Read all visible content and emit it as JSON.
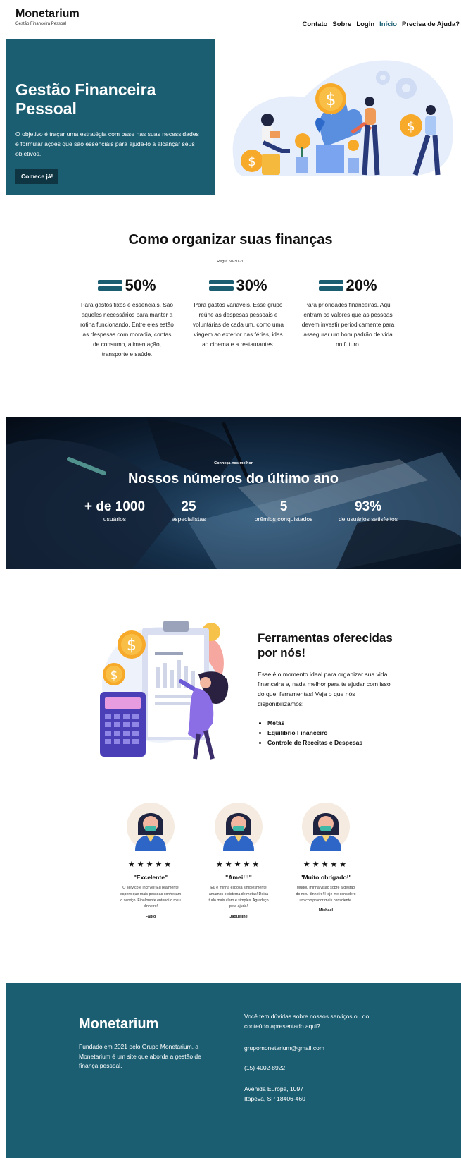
{
  "header": {
    "brand": "Monetarium",
    "tagline": "Gestão Financeira Pessoal",
    "nav": [
      "Contato",
      "Sobre",
      "Login",
      "Início",
      "Precisa de Ajuda?"
    ]
  },
  "hero": {
    "title": "Gestão Financeira Pessoal",
    "text": "O objetivo é traçar uma estratégia com base nas suas necessidades e formular ações que são essenciais para ajudá-lo a alcançar seus objetivos.",
    "button": "Comece já!"
  },
  "rule": {
    "title": "Como organizar suas finanças",
    "subtitle": "Regra 50-30-20",
    "columns": [
      {
        "pct": "50%",
        "text": "Para gastos fixos e essenciais. São aqueles necessários para manter a rotina funcionando. Entre eles estão as despesas com moradia, contas de consumo, alimentação, transporte e saúde."
      },
      {
        "pct": "30%",
        "text": "Para gastos variáveis. Esse grupo reúne as despesas pessoais e voluntárias de cada um, como uma viagem ao exterior nas férias, idas ao cinema e a restaurantes."
      },
      {
        "pct": "20%",
        "text": "Para prioridades financeiras. Aqui entram os valores que as pessoas devem investir periodicamente para assegurar um bom padrão de vida no futuro."
      }
    ]
  },
  "stats": {
    "kicker": "Conheça-nos melhor",
    "title": "Nossos números do último ano",
    "items": [
      {
        "num": "+ de 1000",
        "label": "usuários"
      },
      {
        "num": "25",
        "label": "especialistas"
      },
      {
        "num": "5",
        "label": "prêmios conquistados"
      },
      {
        "num": "93%",
        "label": "de usuários satisfeitos"
      }
    ]
  },
  "tools": {
    "title": "Ferramentas oferecidas por nós!",
    "text": "Esse é o momento ideal para organizar sua vida financeira e, nada melhor para te ajudar com isso do que, ferramentas! Veja o que nós disponibilizamos:",
    "list": [
      "Metas",
      "Equilíbrio Financeiro",
      "Controle de Receitas e Despesas"
    ]
  },
  "testimonials": [
    {
      "stars": "★★★★★",
      "title": "\"Excelente\"",
      "text": "O serviço é incrível! Eu realmente espero que mais pessoas conheçam o serviço. Finalmente entendi o meu dinheiro!",
      "name": "Fábio"
    },
    {
      "stars": "★★★★★",
      "title": "\"Amei!!!\"",
      "text": "Eu e minha esposa simplesmente amamos o sistema de metas! Deixa tudo mais claro e simples. Agradeço pela ajuda!",
      "name": "Jaqueline"
    },
    {
      "stars": "★★★★★",
      "title": "\"Muito obrigado!\"",
      "text": "Mudou minha visão sobre a gestão do meu dinheiro! Hoje me considero um comprador mais consciente.",
      "name": "Michael"
    }
  ],
  "footer": {
    "brand": "Monetarium",
    "about": "Fundado em 2021 pelo Grupo Monetarium, a Monetarium é um site que aborda a gestão de finança pessoal.",
    "question": "Você tem dúvidas sobre nossos serviços ou do conteúdo apresentado aqui?",
    "email": "grupomonetarium@gmail.com",
    "phone": "(15) 4002-8922",
    "address_line1": "Avenida Europa, 1097",
    "address_line2": "Itapeva, SP 18406-460"
  },
  "colors": {
    "primary": "#1b5e72",
    "dark": "#0f3442",
    "accent_gold": "#f7a92a",
    "accent_purple": "#6b5bd6"
  },
  "icons": [
    "equal-bars-icon",
    "coin-icon",
    "gear-icon",
    "star-icon",
    "avatar-icon"
  ]
}
